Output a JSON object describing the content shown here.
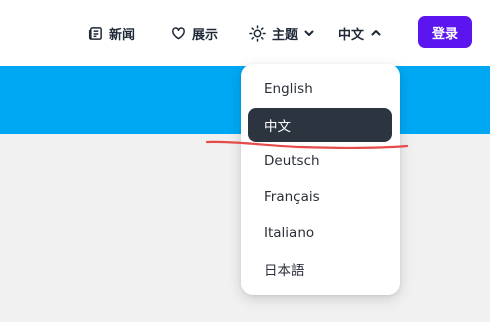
{
  "nav": {
    "news_label": "新闻",
    "showcase_label": "展示",
    "theme_label": "主题",
    "language_label": "中文",
    "login_label": "登录"
  },
  "language_menu": {
    "selected": "中文",
    "options": [
      {
        "label": "English"
      },
      {
        "label": "中文"
      },
      {
        "label": "Deutsch"
      },
      {
        "label": "Français"
      },
      {
        "label": "Italiano"
      },
      {
        "label": "日本語"
      }
    ]
  },
  "icons": {
    "news": "newspaper-icon",
    "showcase": "heart-icon",
    "theme": "sun-icon",
    "theme_dropdown": "chevron-down-icon",
    "language_dropdown": "chevron-up-icon"
  },
  "colors": {
    "brand_button": "#5b16f0",
    "hero_band": "#00a8f4",
    "content_background": "#f1f1f1",
    "active_option": "#2c3440",
    "annotation_underline": "#e64b4b"
  }
}
